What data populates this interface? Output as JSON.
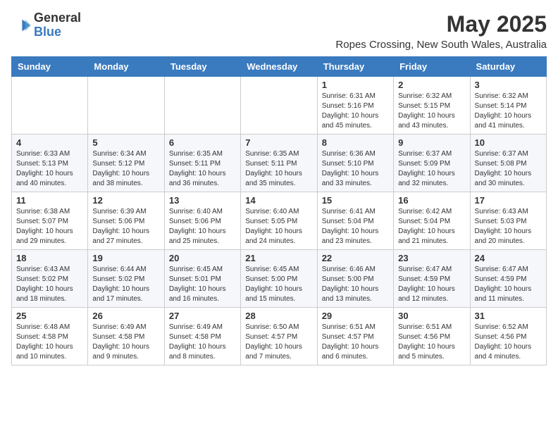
{
  "logo": {
    "general": "General",
    "blue": "Blue"
  },
  "header": {
    "month_year": "May 2025",
    "location": "Ropes Crossing, New South Wales, Australia"
  },
  "days_of_week": [
    "Sunday",
    "Monday",
    "Tuesday",
    "Wednesday",
    "Thursday",
    "Friday",
    "Saturday"
  ],
  "weeks": [
    [
      {
        "day": "",
        "info": ""
      },
      {
        "day": "",
        "info": ""
      },
      {
        "day": "",
        "info": ""
      },
      {
        "day": "",
        "info": ""
      },
      {
        "day": "1",
        "info": "Sunrise: 6:31 AM\nSunset: 5:16 PM\nDaylight: 10 hours\nand 45 minutes."
      },
      {
        "day": "2",
        "info": "Sunrise: 6:32 AM\nSunset: 5:15 PM\nDaylight: 10 hours\nand 43 minutes."
      },
      {
        "day": "3",
        "info": "Sunrise: 6:32 AM\nSunset: 5:14 PM\nDaylight: 10 hours\nand 41 minutes."
      }
    ],
    [
      {
        "day": "4",
        "info": "Sunrise: 6:33 AM\nSunset: 5:13 PM\nDaylight: 10 hours\nand 40 minutes."
      },
      {
        "day": "5",
        "info": "Sunrise: 6:34 AM\nSunset: 5:12 PM\nDaylight: 10 hours\nand 38 minutes."
      },
      {
        "day": "6",
        "info": "Sunrise: 6:35 AM\nSunset: 5:11 PM\nDaylight: 10 hours\nand 36 minutes."
      },
      {
        "day": "7",
        "info": "Sunrise: 6:35 AM\nSunset: 5:11 PM\nDaylight: 10 hours\nand 35 minutes."
      },
      {
        "day": "8",
        "info": "Sunrise: 6:36 AM\nSunset: 5:10 PM\nDaylight: 10 hours\nand 33 minutes."
      },
      {
        "day": "9",
        "info": "Sunrise: 6:37 AM\nSunset: 5:09 PM\nDaylight: 10 hours\nand 32 minutes."
      },
      {
        "day": "10",
        "info": "Sunrise: 6:37 AM\nSunset: 5:08 PM\nDaylight: 10 hours\nand 30 minutes."
      }
    ],
    [
      {
        "day": "11",
        "info": "Sunrise: 6:38 AM\nSunset: 5:07 PM\nDaylight: 10 hours\nand 29 minutes."
      },
      {
        "day": "12",
        "info": "Sunrise: 6:39 AM\nSunset: 5:06 PM\nDaylight: 10 hours\nand 27 minutes."
      },
      {
        "day": "13",
        "info": "Sunrise: 6:40 AM\nSunset: 5:06 PM\nDaylight: 10 hours\nand 25 minutes."
      },
      {
        "day": "14",
        "info": "Sunrise: 6:40 AM\nSunset: 5:05 PM\nDaylight: 10 hours\nand 24 minutes."
      },
      {
        "day": "15",
        "info": "Sunrise: 6:41 AM\nSunset: 5:04 PM\nDaylight: 10 hours\nand 23 minutes."
      },
      {
        "day": "16",
        "info": "Sunrise: 6:42 AM\nSunset: 5:04 PM\nDaylight: 10 hours\nand 21 minutes."
      },
      {
        "day": "17",
        "info": "Sunrise: 6:43 AM\nSunset: 5:03 PM\nDaylight: 10 hours\nand 20 minutes."
      }
    ],
    [
      {
        "day": "18",
        "info": "Sunrise: 6:43 AM\nSunset: 5:02 PM\nDaylight: 10 hours\nand 18 minutes."
      },
      {
        "day": "19",
        "info": "Sunrise: 6:44 AM\nSunset: 5:02 PM\nDaylight: 10 hours\nand 17 minutes."
      },
      {
        "day": "20",
        "info": "Sunrise: 6:45 AM\nSunset: 5:01 PM\nDaylight: 10 hours\nand 16 minutes."
      },
      {
        "day": "21",
        "info": "Sunrise: 6:45 AM\nSunset: 5:00 PM\nDaylight: 10 hours\nand 15 minutes."
      },
      {
        "day": "22",
        "info": "Sunrise: 6:46 AM\nSunset: 5:00 PM\nDaylight: 10 hours\nand 13 minutes."
      },
      {
        "day": "23",
        "info": "Sunrise: 6:47 AM\nSunset: 4:59 PM\nDaylight: 10 hours\nand 12 minutes."
      },
      {
        "day": "24",
        "info": "Sunrise: 6:47 AM\nSunset: 4:59 PM\nDaylight: 10 hours\nand 11 minutes."
      }
    ],
    [
      {
        "day": "25",
        "info": "Sunrise: 6:48 AM\nSunset: 4:58 PM\nDaylight: 10 hours\nand 10 minutes."
      },
      {
        "day": "26",
        "info": "Sunrise: 6:49 AM\nSunset: 4:58 PM\nDaylight: 10 hours\nand 9 minutes."
      },
      {
        "day": "27",
        "info": "Sunrise: 6:49 AM\nSunset: 4:58 PM\nDaylight: 10 hours\nand 8 minutes."
      },
      {
        "day": "28",
        "info": "Sunrise: 6:50 AM\nSunset: 4:57 PM\nDaylight: 10 hours\nand 7 minutes."
      },
      {
        "day": "29",
        "info": "Sunrise: 6:51 AM\nSunset: 4:57 PM\nDaylight: 10 hours\nand 6 minutes."
      },
      {
        "day": "30",
        "info": "Sunrise: 6:51 AM\nSunset: 4:56 PM\nDaylight: 10 hours\nand 5 minutes."
      },
      {
        "day": "31",
        "info": "Sunrise: 6:52 AM\nSunset: 4:56 PM\nDaylight: 10 hours\nand 4 minutes."
      }
    ]
  ]
}
